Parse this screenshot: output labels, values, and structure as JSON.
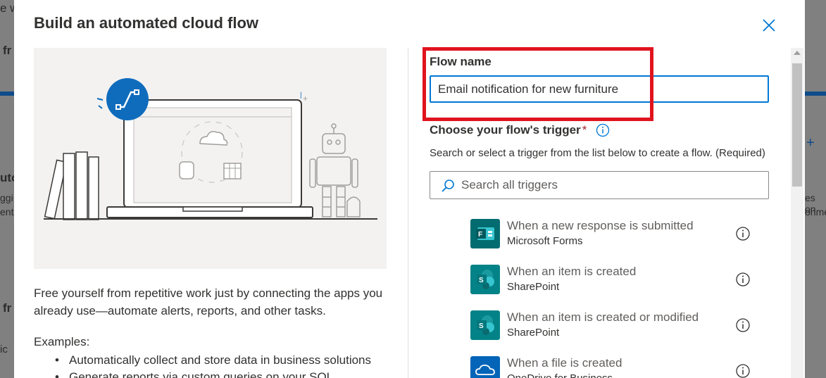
{
  "background": {
    "fragments": [
      "e w",
      "fr",
      "uto",
      "ggi",
      "ent",
      "fr",
      "ic",
      "es on",
      "onme",
      "+"
    ]
  },
  "dialog": {
    "title": "Build an automated cloud flow",
    "close_icon": "close-icon",
    "description": "Free yourself from repetitive work just by connecting the apps you already use—automate alerts, reports, and other tasks.",
    "examples_label": "Examples:",
    "examples": [
      "Automatically collect and store data in business solutions",
      "Generate reports via custom queries on your SQL"
    ],
    "flow_name": {
      "label": "Flow name",
      "value": "Email notification for new furniture"
    },
    "trigger": {
      "label": "Choose your flow's trigger",
      "required_mark": "*",
      "help": "Search or select a trigger from the list below to create a flow. (Required)",
      "search_placeholder": "Search all triggers",
      "items": [
        {
          "title": "When a new response is submitted",
          "subtitle": "Microsoft Forms",
          "icon": "forms-icon",
          "color": "#036c70"
        },
        {
          "title": "When an item is created",
          "subtitle": "SharePoint",
          "icon": "sharepoint-icon",
          "color": "#038387"
        },
        {
          "title": "When an item is created or modified",
          "subtitle": "SharePoint",
          "icon": "sharepoint-icon",
          "color": "#038387"
        },
        {
          "title": "When a file is created",
          "subtitle": "OneDrive for Business",
          "icon": "onedrive-icon",
          "color": "#0364b8"
        }
      ]
    }
  },
  "colors": {
    "accent": "#0078d4",
    "highlight": "#e0141e"
  }
}
